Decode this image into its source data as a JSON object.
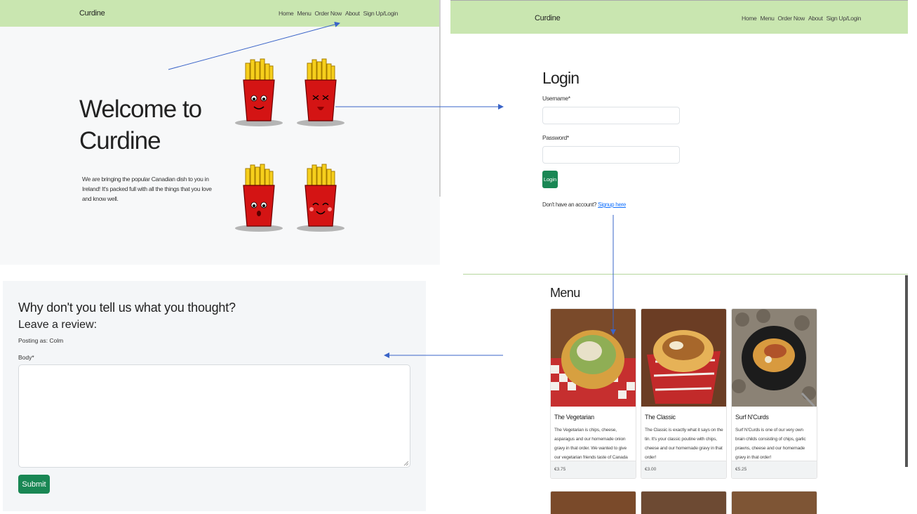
{
  "nav": {
    "brand": "Curdine",
    "links": [
      "Home",
      "Menu",
      "Order Now",
      "About",
      "Sign Up/Login"
    ]
  },
  "home": {
    "welcome_line1": "Welcome to",
    "welcome_line2": "Curdine",
    "intro": "We are bringing the popular Canadian dish to you in Ireland! It's packed full with all the things that you love and know well."
  },
  "login": {
    "title": "Login",
    "username_label": "Username*",
    "password_label": "Password*",
    "button": "Login",
    "no_account_text": "Don't have an account?",
    "signup_link": "Signup here"
  },
  "review": {
    "heading": "Why don't you tell us what you thought?",
    "subheading": "Leave a review:",
    "posting_as": "Posting as: Colm",
    "body_label": "Body*",
    "submit": "Submit"
  },
  "menu": {
    "title": "Menu",
    "items": [
      {
        "name": "The Vegetarian",
        "description": "The Vegetarian is chips, cheese, asparagus and our homemade onion gravy in that order. We wanted to give our vegetarian friends taste of Canada too!",
        "price": "€3.75"
      },
      {
        "name": "The Classic",
        "description": "The Classic is exactly what it says on the tin. It's your classic poutine with chips, cheese and our homemade gravy in that order!",
        "price": "€3.00"
      },
      {
        "name": "Surf N'Curds",
        "description": "Surf N'Curds is one of our very own brain childs consisting of chips, garlic prawns, cheese and our homemade gravy in that order!",
        "price": "€5.25"
      }
    ]
  },
  "colors": {
    "navbar": "#c9e6b0",
    "button_green": "#198754",
    "arrow": "#3a64c8",
    "link": "#0d6efd"
  }
}
